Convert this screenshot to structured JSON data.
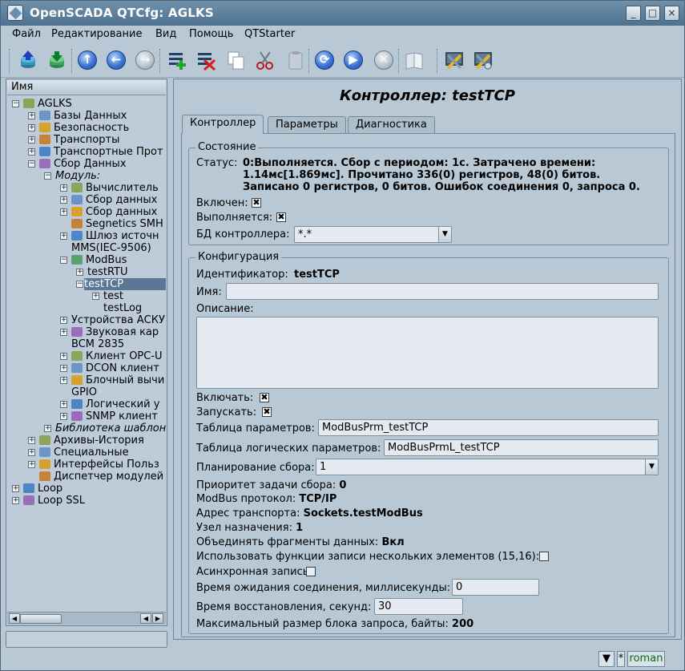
{
  "window": {
    "title": "OpenSCADA QTCfg: AGLKS",
    "controls": {
      "minimize": "_",
      "maximize": "□",
      "close": "×"
    }
  },
  "menu": [
    "Файл",
    "Редактирование",
    "Вид",
    "Помощь",
    "QTStarter"
  ],
  "toolbar": [
    "db-load-icon",
    "db-save-icon",
    "up-icon",
    "back-icon",
    "forward-icon",
    "add-item-icon",
    "delete-item-icon",
    "copy-icon",
    "cut-icon",
    "paste-icon",
    "refresh-icon",
    "start-icon",
    "stop-icon",
    "help-book-icon",
    "tools-icon",
    "settings-tools-icon"
  ],
  "tree": {
    "header": "Имя",
    "items": [
      {
        "label": "AGLKS",
        "level": 0,
        "exp": "-"
      },
      {
        "label": "Базы Данных",
        "level": 1,
        "exp": "+"
      },
      {
        "label": "Безопасность",
        "level": 1,
        "exp": "+"
      },
      {
        "label": "Транспорты",
        "level": 1,
        "exp": "+"
      },
      {
        "label": "Транспортные Прот",
        "level": 1,
        "exp": "+"
      },
      {
        "label": "Сбор Данных",
        "level": 1,
        "exp": "-"
      },
      {
        "label": "Модуль:",
        "level": 2,
        "exp": "-",
        "italic": true
      },
      {
        "label": "Вычислитель",
        "level": 3,
        "exp": "+"
      },
      {
        "label": "Сбор данных",
        "level": 3,
        "exp": "+"
      },
      {
        "label": "Сбор данных",
        "level": 3,
        "exp": "+"
      },
      {
        "label": "Segnetics SMH",
        "level": 3,
        "exp": ""
      },
      {
        "label": "Шлюз источн",
        "level": 3,
        "exp": "+"
      },
      {
        "label": "MMS(IEC-9506)",
        "level": 3,
        "exp": "",
        "noicon": true
      },
      {
        "label": "ModBus",
        "level": 3,
        "exp": "-"
      },
      {
        "label": "testRTU",
        "level": 4,
        "exp": "+",
        "noicon": true
      },
      {
        "label": "testTCP",
        "level": 4,
        "exp": "-",
        "noicon": true,
        "selected": true
      },
      {
        "label": "test",
        "level": 5,
        "exp": "+",
        "noicon": true
      },
      {
        "label": "testLog",
        "level": 5,
        "exp": "",
        "noicon": true
      },
      {
        "label": "Устройства АСКУ",
        "level": 3,
        "exp": "+",
        "noicon": true
      },
      {
        "label": "Звуковая кар",
        "level": 3,
        "exp": "+"
      },
      {
        "label": "BCM 2835",
        "level": 3,
        "exp": "",
        "noicon": true
      },
      {
        "label": "Клиент OPC-U",
        "level": 3,
        "exp": "+"
      },
      {
        "label": "DCON клиент",
        "level": 3,
        "exp": "+"
      },
      {
        "label": "Блочный вычи",
        "level": 3,
        "exp": "+"
      },
      {
        "label": "GPIO",
        "level": 3,
        "exp": "",
        "noicon": true
      },
      {
        "label": "Логический у",
        "level": 3,
        "exp": "+"
      },
      {
        "label": "SNMP клиент",
        "level": 3,
        "exp": "+"
      },
      {
        "label": "Библиотека шаблон",
        "level": 2,
        "exp": "+",
        "italic": true
      },
      {
        "label": "Архивы-История",
        "level": 1,
        "exp": "+"
      },
      {
        "label": "Специальные",
        "level": 1,
        "exp": "+"
      },
      {
        "label": "Интерфейсы Польз",
        "level": 1,
        "exp": "+"
      },
      {
        "label": "Диспетчер модулей",
        "level": 1,
        "exp": ""
      },
      {
        "label": "Loop",
        "level": 0,
        "exp": "+"
      },
      {
        "label": "Loop SSL",
        "level": 0,
        "exp": "+"
      }
    ]
  },
  "page": {
    "title": "Контроллер: testTCP",
    "tabs": [
      "Контроллер",
      "Параметры",
      "Диагностика"
    ],
    "state": {
      "group_title": "Состояние",
      "status_label": "Статус:",
      "status_lines": [
        "0:Выполняется. Сбор с периодом: 1с. Затрачено времени:",
        "1.14мс[1.869мс]. Прочитано 336(0) регистров, 48(0) битов.",
        "Записано 0 регистров, 0 битов. Ошибок соединения 0, запроса 0."
      ],
      "enabled_label": "Включен:",
      "running_label": "Выполняется:",
      "db_label": "БД контроллера:",
      "db_value": "*.*"
    },
    "config": {
      "group_title": "Конфигурация",
      "id_label": "Идентификатор:",
      "id_value": "testTCP",
      "name_label": "Имя:",
      "name_value": "",
      "descr_label": "Описание:",
      "descr_value": "",
      "enable_label": "Включать:",
      "start_label": "Запускать:",
      "params_table_label": "Таблица параметров:",
      "params_table_value": "ModBusPrm_testTCP",
      "logic_table_label": "Таблица логических параметров:",
      "logic_table_value": "ModBusPrmL_testTCP",
      "schedule_label": "Планирование сбора:",
      "schedule_value": "1",
      "priority_label": "Приоритет задачи сбора:",
      "priority_value": "0",
      "protocol_label": "ModBus протокол:",
      "protocol_value": "TCP/IP",
      "transport_label": "Адрес транспорта:",
      "transport_value": "Sockets.testModBus",
      "node_label": "Узел назначения:",
      "node_value": "1",
      "merge_label": "Объединять фрагменты данных:",
      "merge_value": "Вкл",
      "multi_write_label": "Использовать функции записи нескольких элементов (15,16):",
      "async_label": "Асинхронная запись:",
      "conn_timeout_label": "Время ожидания соединения, миллисекунды:",
      "conn_timeout_value": "0",
      "restore_label": "Время восстановления, секунд:",
      "restore_value": "30",
      "max_block_label": "Максимальный размер блока запроса, байты:",
      "max_block_value": "200"
    }
  },
  "statusbar": {
    "modified": "*",
    "user": "roman"
  },
  "checks": {
    "mark": "✖",
    "enabled": true,
    "running": true,
    "enable": true,
    "start": true,
    "multi_write": false,
    "async": false
  }
}
